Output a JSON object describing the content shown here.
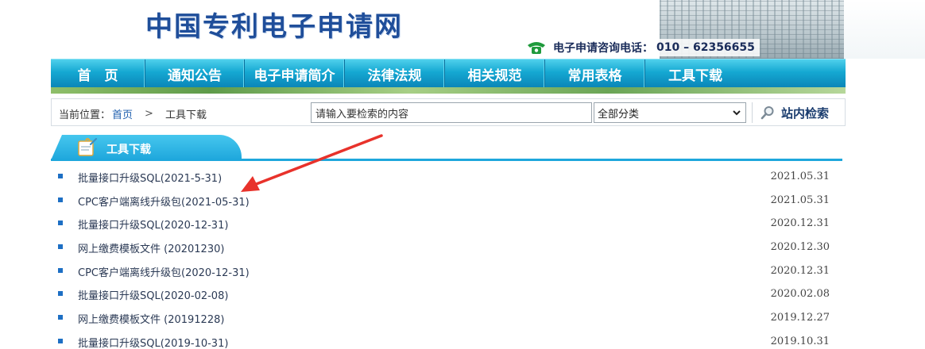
{
  "header": {
    "site_title": "中国专利电子申请网",
    "hotline_label": "电子申请咨询电话：",
    "hotline_number": "010 – 62356655",
    "phone_icon": "phone-icon"
  },
  "nav": {
    "items": [
      {
        "label": "首　页"
      },
      {
        "label": "通知公告"
      },
      {
        "label": "电子申请简介"
      },
      {
        "label": "法律法规"
      },
      {
        "label": "相关规范"
      },
      {
        "label": "常用表格"
      },
      {
        "label": "工具下载"
      }
    ]
  },
  "breadcrumb": {
    "prefix": "当前位置：",
    "home": "首页",
    "separator": ">",
    "current": "工具下载"
  },
  "search": {
    "value": "请输入要检索的内容",
    "category_selected": "全部分类",
    "button_label": "站内检索"
  },
  "section": {
    "title": "工具下载"
  },
  "downloads": [
    {
      "title": "批量接口升级SQL(2021-5-31)",
      "date": "2021.05.31"
    },
    {
      "title": "CPC客户端离线升级包(2021-05-31)",
      "date": "2021.05.31"
    },
    {
      "title": "批量接口升级SQL(2020-12-31)",
      "date": "2020.12.31"
    },
    {
      "title": "网上缴费模板文件 (20201230)",
      "date": "2020.12.30"
    },
    {
      "title": "CPC客户端离线升级包(2020-12-31)",
      "date": "2020.12.31"
    },
    {
      "title": "批量接口升级SQL(2020-02-08)",
      "date": "2020.02.08"
    },
    {
      "title": "网上缴费模板文件 (20191228)",
      "date": "2019.12.27"
    },
    {
      "title": "批量接口升级SQL(2019-10-31)",
      "date": "2019.10.31"
    }
  ],
  "colors": {
    "nav_top": "#4fd0ec",
    "nav_bottom": "#0b86b8",
    "title": "#1f4e9a",
    "annotation_arrow": "#e8322b"
  }
}
